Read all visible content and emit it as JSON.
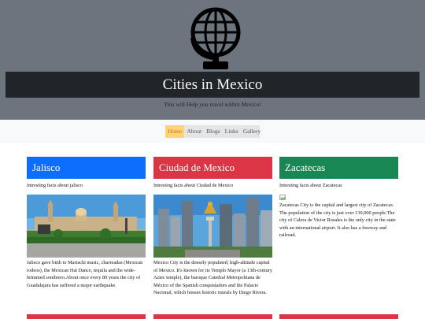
{
  "site": {
    "title": "Cities in Mexico",
    "subtitle": "This will Help you travel within Mexico!"
  },
  "nav": [
    {
      "label": "Home",
      "active": true
    },
    {
      "label": "About"
    },
    {
      "label": "Blogs"
    },
    {
      "label": "Links"
    },
    {
      "label": "Gallery"
    }
  ],
  "cards": [
    {
      "title": "Jalisco",
      "facts": "Intresting facts about jalisco",
      "description": "Jalisco gave birth to Mariachi music, charreadas (Mexican rodeos), the Mexican Hat Dance, tequila and the wide-brimmed sombrero.About once every 80 years the city of Guadalajara has suffered a major earthquake."
    },
    {
      "title": "Ciudad de Mexico",
      "facts": "Intresting facts about Ciudad de Mexico",
      "description": "Mexico City is the densely populated, high-altitude capital of Mexico. It's known for its Templo Mayor (a 13th-century Aztec temple), the baroque Catedral Metropolitana de México of the Spanish conquistadors and the Palacio Nacional, which houses historic murals by Diego Rivera."
    },
    {
      "title": "Zacatecas",
      "facts": "Intresting facts about Zacatecas",
      "description": "Zacatecas City is the capital and largest city of Zacatecas. The population of the city is just over 130,000 people.The city of Calera de Victor Rosales is the only city in the state with an international airport. It also has a freeway and railroad."
    }
  ],
  "colors": {
    "header": "#6c757d",
    "title_bar": "#212529",
    "blue": "#0d6efd",
    "red": "#dc3545",
    "green": "#198754",
    "nav_active": "#ffd37a"
  },
  "icons": {
    "logo": "globe-icon",
    "broken_image": "broken-image-icon"
  }
}
